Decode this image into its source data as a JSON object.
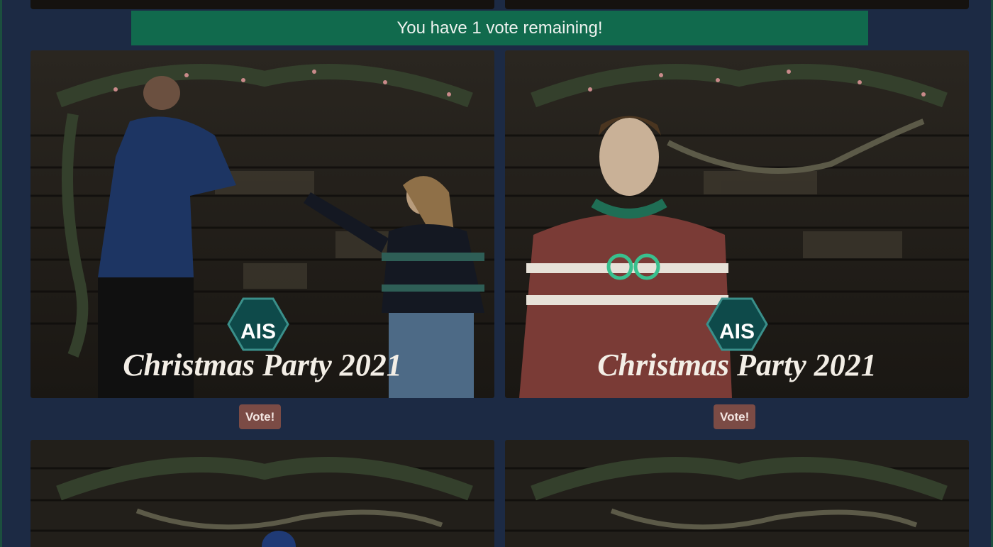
{
  "banner": {
    "message": "You have 1 vote remaining!"
  },
  "photos": [
    {
      "brand_badge": "AIS",
      "caption": "Christmas Party 2021",
      "vote_label": "Vote!"
    },
    {
      "brand_badge": "AIS",
      "caption": "Christmas Party 2021",
      "vote_label": "Vote!"
    },
    {
      "brand_badge": "",
      "caption": "",
      "vote_label": ""
    },
    {
      "brand_badge": "",
      "caption": "",
      "vote_label": ""
    }
  ],
  "colors": {
    "page_background": "#1c2a44",
    "banner_background": "#116a4d",
    "vote_button": "#7b4b45",
    "frame_border": "#1b4f3e"
  }
}
